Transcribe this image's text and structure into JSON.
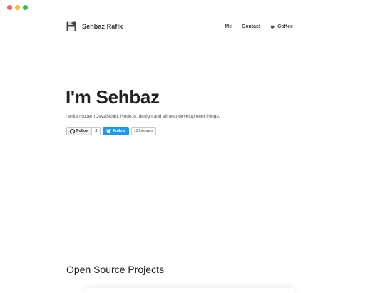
{
  "header": {
    "site_name": "Sehbaz Rafik",
    "nav": [
      {
        "label": "Me"
      },
      {
        "label": "Contact"
      },
      {
        "label": "Coffee",
        "icon": "coffee-cup-icon"
      }
    ]
  },
  "hero": {
    "title": "I'm Sehbaz",
    "subtitle": "I write modern JavaScript, Node.js, design and all web development things."
  },
  "social": {
    "github_follow_label": "Follow",
    "github_count": "2",
    "twitter_follow_label": "Follow",
    "twitter_followers": "13 followers"
  },
  "sections": {
    "open_source_title": "Open Source Projects"
  },
  "colors": {
    "twitter_blue": "#1d9bf0",
    "text_dark": "#222222",
    "window_red": "#fe5f57",
    "window_yellow": "#febc2e",
    "window_green": "#28c840"
  }
}
